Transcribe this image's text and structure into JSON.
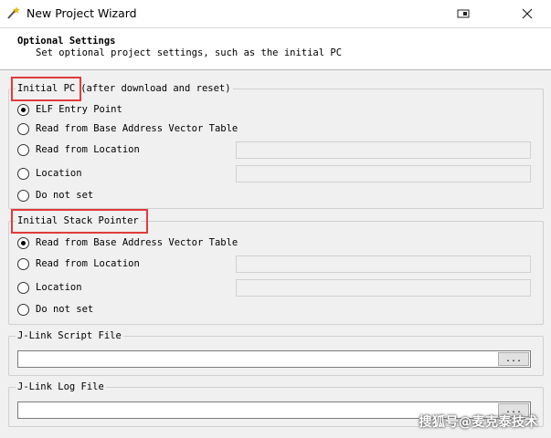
{
  "window": {
    "title": "New Project Wizard"
  },
  "header": {
    "title": "Optional Settings",
    "description": "Set optional project settings, such as the initial PC"
  },
  "initial_pc": {
    "legend": "Initial PC",
    "legend_suffix": "(after download and reset)",
    "options": [
      {
        "label": "ELF Entry Point",
        "checked": true
      },
      {
        "label": "Read from Base Address Vector Table",
        "checked": false
      },
      {
        "label": "Read from Location",
        "checked": false
      },
      {
        "label": "Location",
        "checked": false
      },
      {
        "label": "Do not set",
        "checked": false
      }
    ],
    "read_location_value": "",
    "location_value": ""
  },
  "initial_sp": {
    "legend": "Initial Stack Pointer",
    "options": [
      {
        "label": "Read from Base Address Vector Table",
        "checked": true
      },
      {
        "label": "Read from Location",
        "checked": false
      },
      {
        "label": "Location",
        "checked": false
      },
      {
        "label": "Do not set",
        "checked": false
      }
    ],
    "read_location_value": "",
    "location_value": ""
  },
  "script_file": {
    "legend": "J-Link Script File",
    "value": "",
    "browse_label": "..."
  },
  "log_file": {
    "legend": "J-Link Log File",
    "value": "",
    "browse_label": "..."
  },
  "watermark": "搜狐号@麦克泰技术",
  "colors": {
    "highlight": "#e23a3a",
    "background": "#f0f0f0"
  }
}
